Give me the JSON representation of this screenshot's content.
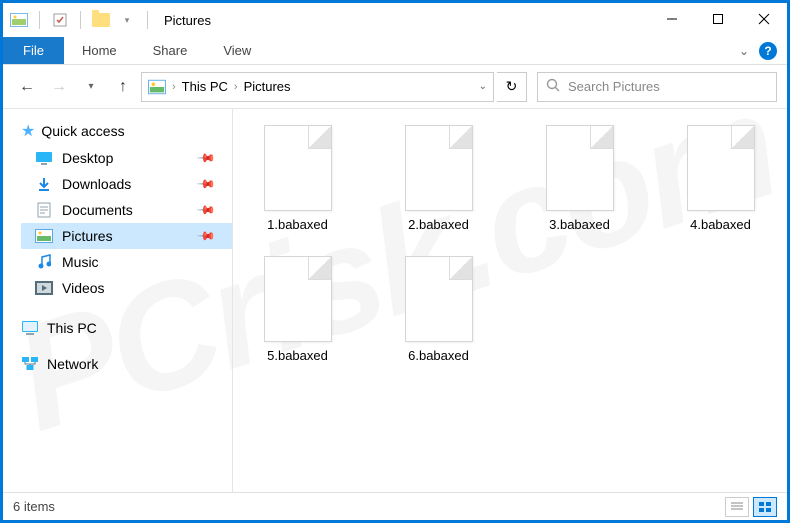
{
  "window": {
    "title": "Pictures"
  },
  "ribbon": {
    "file": "File",
    "tabs": [
      "Home",
      "Share",
      "View"
    ]
  },
  "breadcrumb": {
    "root": "This PC",
    "current": "Pictures"
  },
  "search": {
    "placeholder": "Search Pictures"
  },
  "sidebar": {
    "quick_access": "Quick access",
    "items": [
      {
        "label": "Desktop"
      },
      {
        "label": "Downloads"
      },
      {
        "label": "Documents"
      },
      {
        "label": "Pictures"
      },
      {
        "label": "Music"
      },
      {
        "label": "Videos"
      }
    ],
    "this_pc": "This PC",
    "network": "Network"
  },
  "files": [
    {
      "name": "1.babaxed"
    },
    {
      "name": "2.babaxed"
    },
    {
      "name": "3.babaxed"
    },
    {
      "name": "4.babaxed"
    },
    {
      "name": "5.babaxed"
    },
    {
      "name": "6.babaxed"
    }
  ],
  "status": {
    "count": "6 items"
  },
  "watermark": "PCrisk.com"
}
